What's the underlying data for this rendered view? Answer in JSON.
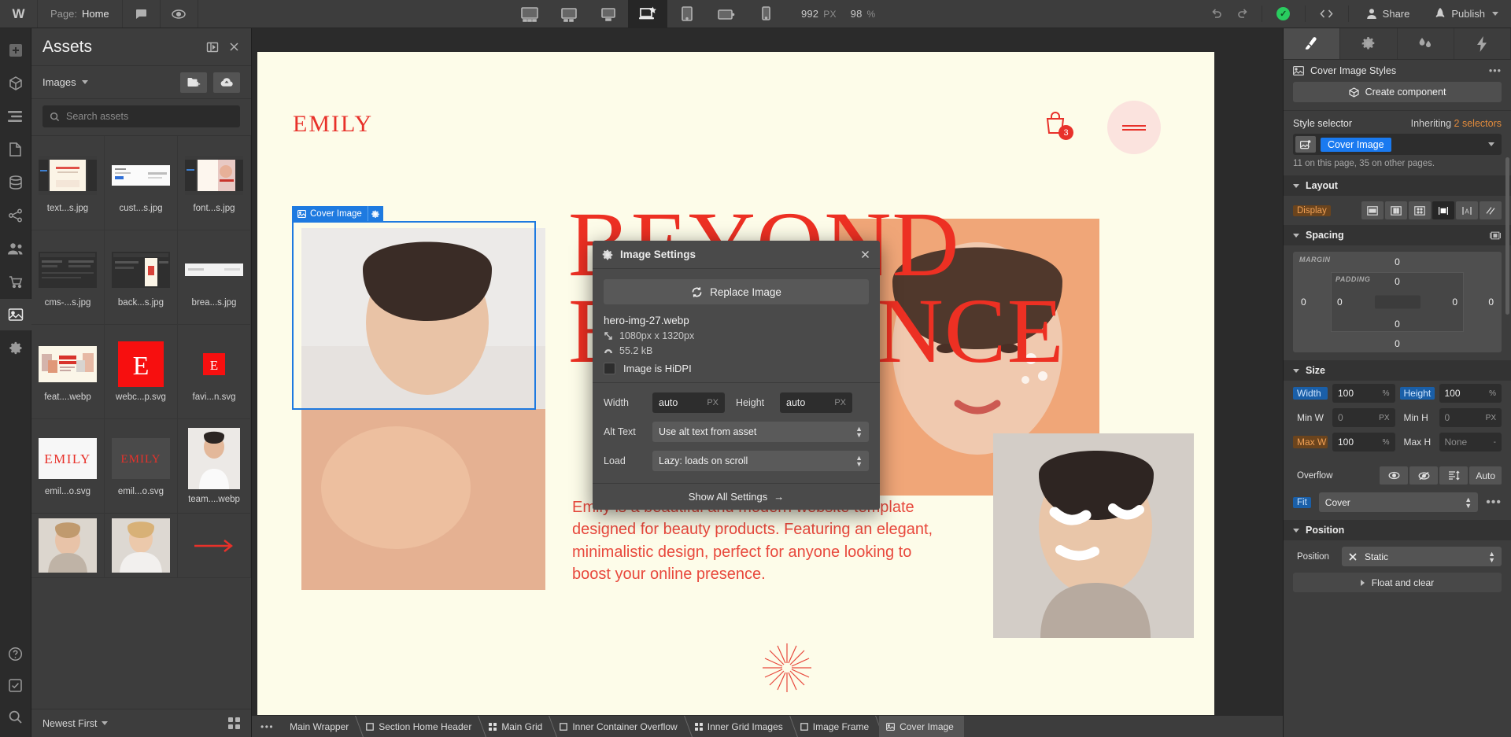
{
  "topbar": {
    "logo": "W",
    "page_label": "Page:",
    "page_value": "Home",
    "comment_icon": "comment-icon",
    "preview_icon": "eye-icon",
    "devices": [
      {
        "name": "desktop-xl",
        "active": false
      },
      {
        "name": "desktop-l",
        "active": false
      },
      {
        "name": "desktop",
        "active": false
      },
      {
        "name": "laptop-base",
        "active": true
      },
      {
        "name": "tablet",
        "active": false
      },
      {
        "name": "mobile-landscape",
        "active": false
      },
      {
        "name": "mobile-portrait",
        "active": false
      }
    ],
    "width_value": "992",
    "width_unit": "PX",
    "zoom_value": "98",
    "zoom_unit": "%",
    "undo_icon": "undo-icon",
    "redo_icon": "redo-icon",
    "status_icon": "check-circle-icon",
    "code_icon": "code-brackets-icon",
    "share_label": "Share",
    "publish_label": "Publish"
  },
  "rail": {
    "items": [
      {
        "name": "add-panel",
        "icon": "plus-icon",
        "active": false
      },
      {
        "name": "components-panel",
        "icon": "cube-icon",
        "active": false
      },
      {
        "name": "navigator-panel",
        "icon": "layers-icon",
        "active": false
      },
      {
        "name": "pages-panel",
        "icon": "page-icon",
        "active": false
      },
      {
        "name": "cms-panel",
        "icon": "database-icon",
        "active": false
      },
      {
        "name": "ecommerce-panel",
        "icon": "node-icon",
        "active": false
      },
      {
        "name": "users-panel",
        "icon": "users-icon",
        "active": false
      },
      {
        "name": "shop-panel",
        "icon": "cart-icon",
        "active": false
      },
      {
        "name": "assets-panel",
        "icon": "image-icon",
        "active": true
      },
      {
        "name": "settings-panel",
        "icon": "gear-icon",
        "active": false
      }
    ],
    "bottom_items": [
      {
        "name": "help",
        "icon": "question-icon"
      },
      {
        "name": "audit",
        "icon": "checkbox-icon"
      },
      {
        "name": "search",
        "icon": "search-icon"
      }
    ]
  },
  "assets": {
    "title": "Assets",
    "collapse_icon": "panel-collapse-icon",
    "close_icon": "close-icon",
    "filter_label": "Images",
    "new_folder_icon": "new-folder-icon",
    "upload_icon": "upload-cloud-icon",
    "search_placeholder": "Search assets",
    "search_icon": "search-icon",
    "items": [
      {
        "name": "text...s.jpg",
        "kind": "screenshot-light"
      },
      {
        "name": "cust...s.jpg",
        "kind": "screenshot-white"
      },
      {
        "name": "font...s.jpg",
        "kind": "screenshot-portrait"
      },
      {
        "name": "cms-...s.jpg",
        "kind": "screenshot-dark"
      },
      {
        "name": "back...s.jpg",
        "kind": "screenshot-dark2"
      },
      {
        "name": "brea...s.jpg",
        "kind": "screenshot-bar"
      },
      {
        "name": "feat....webp",
        "kind": "banner-cream"
      },
      {
        "name": "webc...p.svg",
        "kind": "red-e"
      },
      {
        "name": "favi...n.svg",
        "kind": "red-e-small"
      },
      {
        "name": "emil...o.svg",
        "kind": "wordmark-red"
      },
      {
        "name": "emil...o.svg",
        "kind": "wordmark-red2"
      },
      {
        "name": "team....webp",
        "kind": "photo-person"
      },
      {
        "name": "",
        "kind": "photo-woman1"
      },
      {
        "name": "",
        "kind": "photo-woman2"
      },
      {
        "name": "",
        "kind": "red-arrow"
      }
    ],
    "footer_sort": "Newest First",
    "footer_grid_icon": "grid-view-icon"
  },
  "canvas": {
    "site": {
      "brand": "EMILY",
      "cart_icon": "shopping-bag-icon",
      "cart_count": "3",
      "menu_icon": "hamburger-icon",
      "headline_line1": "BEYOND",
      "headline_line2": "ELEGANCE",
      "body_text": "Emily is a beautiful and modern website template designed for beauty products. Featuring an elegant, minimalistic design, perfect for anyone looking to boost your online presence.",
      "sparkle_icon": "sparkle-icon"
    },
    "selection": {
      "label": "Cover Image",
      "label_icon": "image-icon",
      "settings_icon": "gear-icon",
      "accent_color": "#1e7ae0"
    }
  },
  "modal": {
    "title": "Image Settings",
    "title_icon": "gear-icon",
    "close_icon": "close-icon",
    "replace_label": "Replace Image",
    "replace_icon": "refresh-icon",
    "file_name": "hero-img-27.webp",
    "dimensions": "1080px x 1320px",
    "dimensions_icon": "resize-icon",
    "file_size": "55.2 kB",
    "file_size_icon": "gauge-icon",
    "hidpi_label": "Image is HiDPI",
    "width_label": "Width",
    "width_value": "auto",
    "width_unit": "PX",
    "height_label": "Height",
    "height_value": "auto",
    "height_unit": "PX",
    "alt_label": "Alt Text",
    "alt_value": "Use alt text from asset",
    "load_label": "Load",
    "load_value": "Lazy: loads on scroll",
    "show_all_label": "Show All Settings",
    "show_all_arrow": "→"
  },
  "breadcrumbs": {
    "overflow": "•••",
    "items": [
      {
        "label": "Main Wrapper",
        "icon": "",
        "active": false
      },
      {
        "label": "Section Home Header",
        "icon": "box-icon",
        "active": false
      },
      {
        "label": "Main Grid",
        "icon": "grid-icon",
        "active": false
      },
      {
        "label": "Inner Container Overflow",
        "icon": "box-icon",
        "active": false
      },
      {
        "label": "Inner Grid Images",
        "icon": "grid-icon",
        "active": false
      },
      {
        "label": "Image Frame",
        "icon": "box-icon",
        "active": false
      },
      {
        "label": "Cover Image",
        "icon": "image-icon",
        "active": true
      }
    ]
  },
  "right": {
    "tabs": [
      {
        "name": "style-tab",
        "icon": "brush-icon",
        "active": true
      },
      {
        "name": "settings-tab",
        "icon": "gear-icon",
        "active": false
      },
      {
        "name": "interactions-tab",
        "icon": "drops-icon",
        "active": false
      },
      {
        "name": "effects-tab",
        "icon": "bolt-icon",
        "active": false
      }
    ],
    "header_title": "Cover Image Styles",
    "header_icon": "image-icon",
    "header_dots": "•••",
    "create_component": "Create component",
    "create_component_icon": "cube-icon",
    "style_selector_label": "Style selector",
    "inheriting_prefix": "Inheriting",
    "inheriting_count": "2 selectors",
    "selector_tag": "Cover Image",
    "selector_icon": "image-state-icon",
    "selector_note": "11 on this page, 35 on other pages.",
    "layout": {
      "title": "Layout",
      "display_label": "Display",
      "options": [
        {
          "name": "display-block",
          "active": false
        },
        {
          "name": "display-flex",
          "active": false
        },
        {
          "name": "display-grid",
          "active": false
        },
        {
          "name": "display-inline-block",
          "active": true
        },
        {
          "name": "display-inline",
          "active": false
        },
        {
          "name": "display-none",
          "active": false
        }
      ]
    },
    "spacing": {
      "title": "Spacing",
      "link_icon": "spacing-link-icon",
      "margin_label": "MARGIN",
      "padding_label": "PADDING",
      "margin_top": "0",
      "margin_right": "0",
      "margin_bottom": "0",
      "margin_left": "0",
      "padding_top": "0",
      "padding_right": "0",
      "padding_bottom": "0",
      "padding_left": "0"
    },
    "size": {
      "title": "Size",
      "width_label": "Width",
      "width_value": "100",
      "width_unit": "%",
      "height_label": "Height",
      "height_value": "100",
      "height_unit": "%",
      "minw_label": "Min W",
      "minw_value": "0",
      "minw_unit": "PX",
      "minh_label": "Min H",
      "minh_value": "0",
      "minh_unit": "PX",
      "maxw_label": "Max W",
      "maxw_value": "100",
      "maxw_unit": "%",
      "maxh_label": "Max H",
      "maxh_value": "None",
      "maxh_unit": "-",
      "overflow_label": "Overflow",
      "overflow_options": [
        {
          "name": "overflow-visible",
          "label": "",
          "icon": "eye-icon"
        },
        {
          "name": "overflow-hidden",
          "label": "",
          "icon": "eye-off-icon"
        },
        {
          "name": "overflow-scroll",
          "label": "",
          "icon": "scroll-icon"
        },
        {
          "name": "overflow-auto",
          "label": "Auto",
          "icon": ""
        }
      ],
      "fit_label": "Fit",
      "fit_value": "Cover",
      "fit_dots": "•••"
    },
    "position": {
      "title": "Position",
      "label": "Position",
      "value": "Static",
      "clear_icon": "x-icon",
      "float_label": "Float and clear"
    }
  }
}
